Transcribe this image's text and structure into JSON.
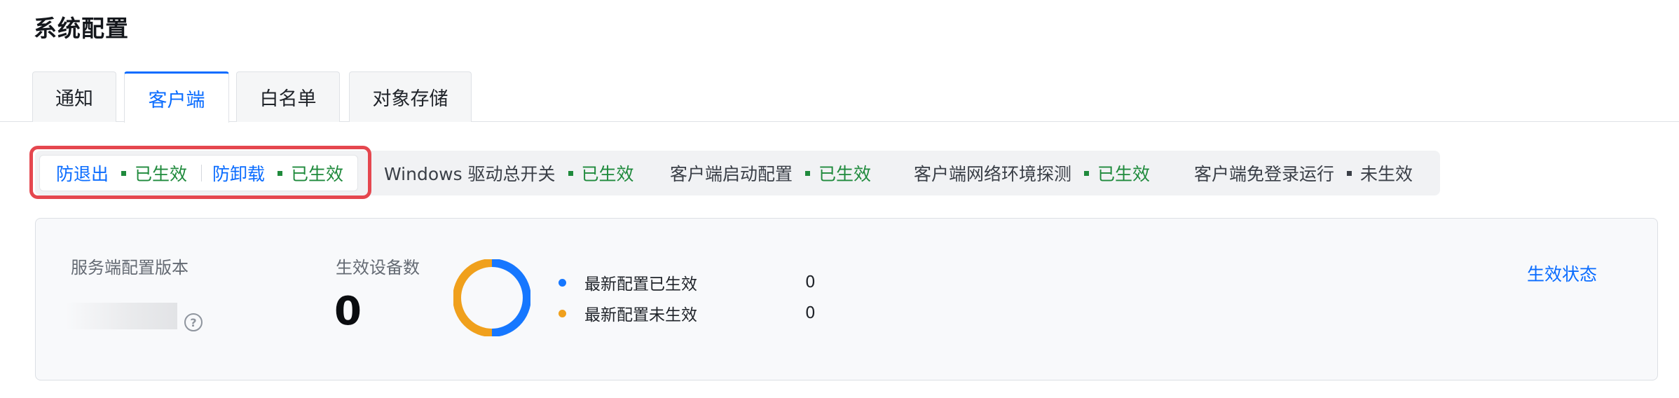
{
  "page": {
    "title": "系统配置"
  },
  "tabs": [
    {
      "label": "通知",
      "active": false
    },
    {
      "label": "客户端",
      "active": true
    },
    {
      "label": "白名单",
      "active": false
    },
    {
      "label": "对象存储",
      "active": false
    }
  ],
  "status_items": [
    {
      "name": "防退出",
      "status": "已生效",
      "link": true
    },
    {
      "name": "防卸载",
      "status": "已生效",
      "link": true
    },
    {
      "name": "Windows 驱动总开关",
      "status": "已生效",
      "link": false
    },
    {
      "name": "客户端启动配置",
      "status": "已生效",
      "link": false
    },
    {
      "name": "客户端网络环境探测",
      "status": "已生效",
      "link": false
    },
    {
      "name": "客户端免登录运行",
      "status": "未生效",
      "link": false
    }
  ],
  "summary": {
    "server_version_label": "服务端配置版本",
    "effective_devices_label": "生效设备数",
    "effective_devices_count": "0",
    "legend": [
      {
        "label": "最新配置已生效",
        "count": "0",
        "color": "#1677ff"
      },
      {
        "label": "最新配置未生效",
        "count": "0",
        "color": "#f0a01c"
      }
    ],
    "status_link": "生效状态"
  },
  "colors": {
    "accent": "#0a6cff",
    "active_status": "#1f8a3c",
    "inactive_status": "#3a3f47",
    "highlight": "#e5474f"
  },
  "icons": {
    "help": "question-circle-icon"
  }
}
